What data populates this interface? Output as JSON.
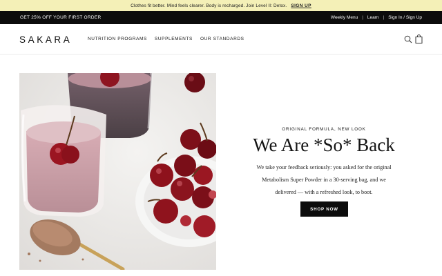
{
  "announcement": {
    "text": "Clothes fit better. Mind feels clearer. Body is recharged. Join Level II: Detox.",
    "cta": "SIGN UP"
  },
  "utility": {
    "promo": "GET 25% OFF YOUR FIRST ORDER",
    "links": [
      "Weekly Menu",
      "Learn",
      "Sign In / Sign Up"
    ],
    "separator": "|"
  },
  "header": {
    "logo": "SAKARA",
    "nav": [
      "NUTRITION PROGRAMS",
      "SUPPLEMENTS",
      "OUR STANDARDS"
    ]
  },
  "hero": {
    "eyebrow": "ORIGINAL FORMULA, NEW LOOK",
    "headline": "We Are *So* Back",
    "body": "We take your feedback seriously: you asked for the original Metabolism Super Powder in a 30-serving bag, and we delivered — with a refreshed look, to boot.",
    "cta": "SHOP NOW"
  },
  "colors": {
    "announcement_bg": "#f4f0b7",
    "utility_bg": "#0c0c0c",
    "button_bg": "#0c0c0c"
  },
  "icons": [
    "search-icon",
    "shopping-bag-icon"
  ]
}
